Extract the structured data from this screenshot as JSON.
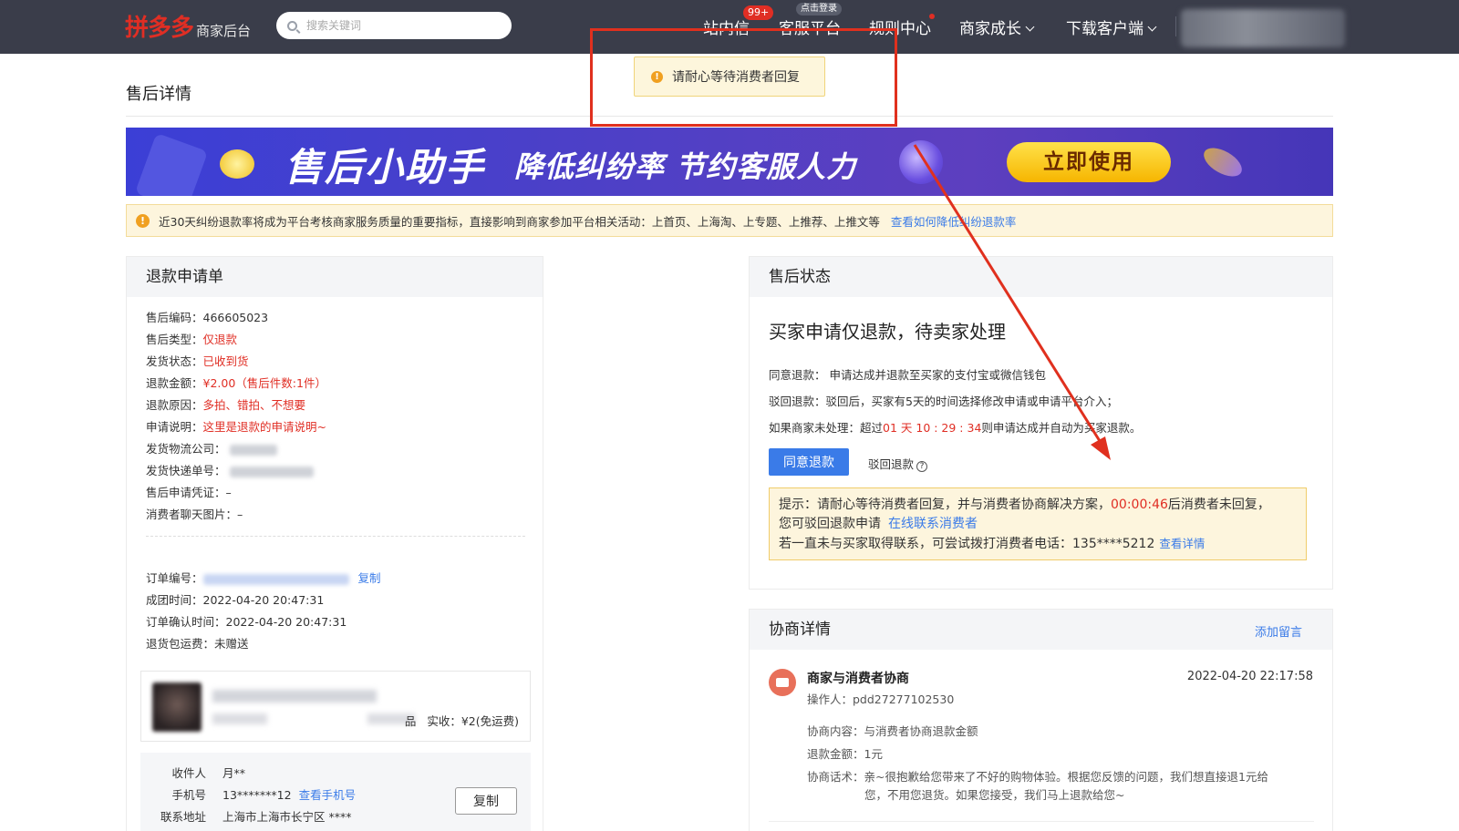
{
  "topbar": {
    "logo_main": "拼多多",
    "logo_sub": "商家后台",
    "search_placeholder": "搜索关键词",
    "nav": [
      {
        "label": "站内信",
        "badge": "99+"
      },
      {
        "label": "客服平台",
        "tip": "点击登录"
      },
      {
        "label": "规则中心"
      },
      {
        "label": "商家成长"
      },
      {
        "label": "下载客户端"
      }
    ]
  },
  "page": {
    "title": "售后详情"
  },
  "toast": {
    "text": "请耐心等待消费者回复"
  },
  "banner": {
    "title": "售后小助手",
    "subtitle": "降低纠纷率 节约客服人力",
    "button": "立即使用"
  },
  "notice": {
    "text": "近30天纠纷退款率将成为平台考核商家服务质量的重要指标，直接影响到商家参加平台相关活动：上首页、上海淘、上专题、上推荐、上推文等",
    "link": "查看如何降低纠纷退款率"
  },
  "refund": {
    "header": "退款申请单",
    "fields": [
      {
        "label": "售后编码：",
        "value": "466605023",
        "style": "normal"
      },
      {
        "label": "售后类型：",
        "value": "仅退款",
        "style": "red"
      },
      {
        "label": "发货状态：",
        "value": "已收到货",
        "style": "red"
      },
      {
        "label": "退款金额：",
        "value": "¥2.00（售后件数:1件）",
        "style": "red"
      },
      {
        "label": "退款原因：",
        "value": "多拍、错拍、不想要",
        "style": "red"
      },
      {
        "label": "申请说明：",
        "value": "这里是退款的申请说明~",
        "style": "red"
      },
      {
        "label": "发货物流公司：",
        "value": "",
        "style": "blur"
      },
      {
        "label": "发货快递单号：",
        "value": "",
        "style": "blur"
      },
      {
        "label": "售后申请凭证：",
        "value": "–",
        "style": "normal"
      },
      {
        "label": "消费者聊天图片：",
        "value": "–",
        "style": "normal"
      }
    ],
    "order": {
      "order_no_label": "订单编号：",
      "copy_link": "复制",
      "group_time_label": "成团时间：",
      "group_time": "2022-04-20 20:47:31",
      "confirm_time_label": "订单确认时间：",
      "confirm_time": "2022-04-20 20:47:31",
      "return_fee_label": "退货包运费：",
      "return_fee": "未赠送"
    },
    "goods": {
      "suffix": "品",
      "paid": "实收：¥2(免运费)"
    },
    "address": {
      "receiver_label": "收件人",
      "receiver": "月**",
      "phone_label": "手机号",
      "phone": "13*******12",
      "phone_link": "查看手机号",
      "addr_label": "联系地址",
      "addr": "上海市上海市长宁区 ****",
      "copy_button": "复制"
    }
  },
  "status": {
    "header": "售后状态",
    "title": "买家申请仅退款，待卖家处理",
    "lines": {
      "agree": "同意退款：  申请达成并退款至买家的支付宝或微信钱包",
      "reject": "驳回退款：驳回后，买家有5天的时间选择修改申请或申请平台介入；",
      "pending_prefix": "如果商家未处理：超过",
      "pending_time": "01 天 10 : 29 : 34",
      "pending_suffix": "则申请达成并自动为买家退款。"
    },
    "agree_button": "同意退款",
    "reject_link": "驳回退款",
    "tip": {
      "line1_prefix": "提示：请耐心等待消费者回复，并与消费者协商解决方案，",
      "line1_time": "00:00:46",
      "line1_suffix": "后消费者未回复，",
      "line2_prefix": "您可驳回退款申请",
      "line2_link": "在线联系消费者",
      "line3_prefix": "若一直未与买家取得联系，可尝试拨打消费者电话：135****5212",
      "line3_link": "查看详情"
    }
  },
  "negotiation": {
    "header": "协商详情",
    "add_note": "添加留言",
    "entry": {
      "title": "商家与消费者协商",
      "time": "2022-04-20 22:17:58",
      "operator": "操作人：pdd27277102530",
      "content": "协商内容：与消费者协商退款金额",
      "amount": "退款金额：1元",
      "script_label": "协商话术：",
      "script_line1": "亲~很抱歉给您带来了不好的购物体验。根据您反馈的问题，我们想直接退1元给",
      "script_line2": "您，不用您退货。如果您接受，我们马上退款给您~"
    }
  },
  "colors": {
    "accent": "#3a7be8",
    "brand": "#e02e24",
    "annotation": "#e0301e",
    "topbar": "#3a3d4a"
  }
}
